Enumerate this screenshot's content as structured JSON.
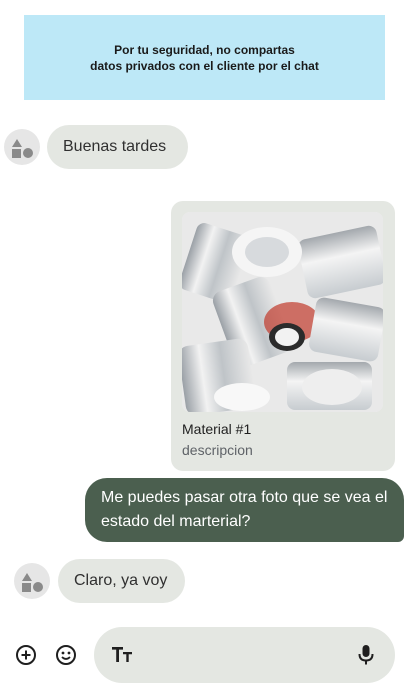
{
  "notice": {
    "line1": "Por tu seguridad, no compartas",
    "line2": "datos privados con el cliente por el chat",
    "background": "#bde8f7"
  },
  "messages": [
    {
      "direction": "incoming",
      "text": "Buenas tardes"
    },
    {
      "direction": "outgoing",
      "type": "attachment",
      "title": "Material #1",
      "description": "descripcion",
      "image": "crushed-metal-cans-photo"
    },
    {
      "direction": "outgoing",
      "text": "Me puedes pasar otra foto que se vea el estado del marterial?"
    },
    {
      "direction": "incoming",
      "text": "Claro, ya voy"
    }
  ],
  "composer": {
    "icons": [
      "add-circle-icon",
      "emoji-icon",
      "text-format-icon",
      "microphone-icon"
    ]
  },
  "colors": {
    "incoming_bubble": "#e4e7e2",
    "outgoing_bubble": "#4b5f4f",
    "avatar": "#e6e6e6"
  }
}
